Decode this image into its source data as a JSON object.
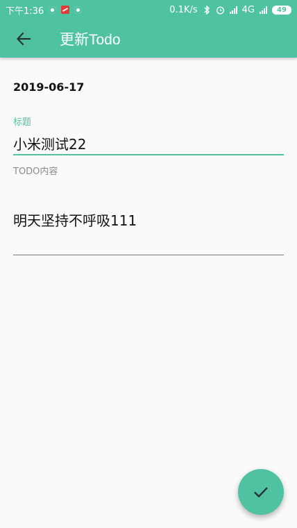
{
  "status_bar": {
    "time": "下午1:36",
    "net_speed": "0.1K/s",
    "network": "4G",
    "battery": "49"
  },
  "app_bar": {
    "title": "更新Todo",
    "back_icon": "arrow-left-icon"
  },
  "form": {
    "date": "2019-06-17",
    "title_label": "标题",
    "title_value": "小米测试22",
    "content_label": "TODO内容",
    "content_value": "明天坚持不呼吸111"
  },
  "fab": {
    "icon": "check-icon"
  },
  "colors": {
    "accent": "#4fc3a1",
    "background": "#fafafa"
  }
}
